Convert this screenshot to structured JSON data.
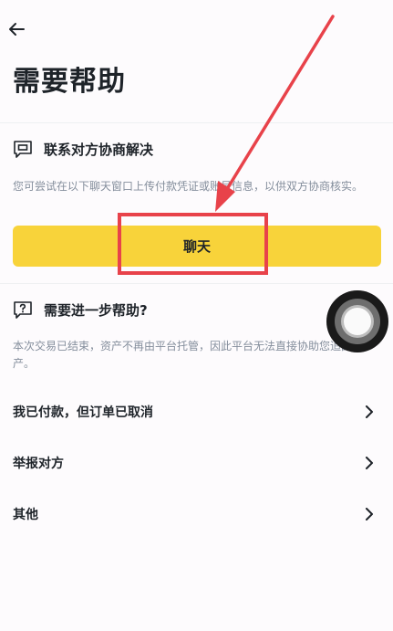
{
  "header": {
    "back_icon": "arrow-left-icon",
    "title": "需要帮助"
  },
  "contact_section": {
    "icon": "chat-bubble-icon",
    "title": "联系对方协商解决",
    "description": "您可尝试在以下聊天窗口上传付款凭证或账号信息，以供双方协商核实。",
    "chat_button_label": "聊天"
  },
  "help_section": {
    "icon": "question-bubble-icon",
    "title": "需要进一步帮助?",
    "description": "本次交易已结束，资产不再由平台托管，因此平台无法直接协助您追回资产。"
  },
  "options": [
    {
      "label": "我已付款，但订单已取消",
      "icon": "chevron-right-icon"
    },
    {
      "label": "举报对方",
      "icon": "chevron-right-icon"
    },
    {
      "label": "其他",
      "icon": "chevron-right-icon"
    }
  ],
  "colors": {
    "accent_yellow": "#f8d33a",
    "annotation_red": "#e8424a",
    "text_primary": "#1e2329",
    "text_secondary": "#848e9c"
  }
}
